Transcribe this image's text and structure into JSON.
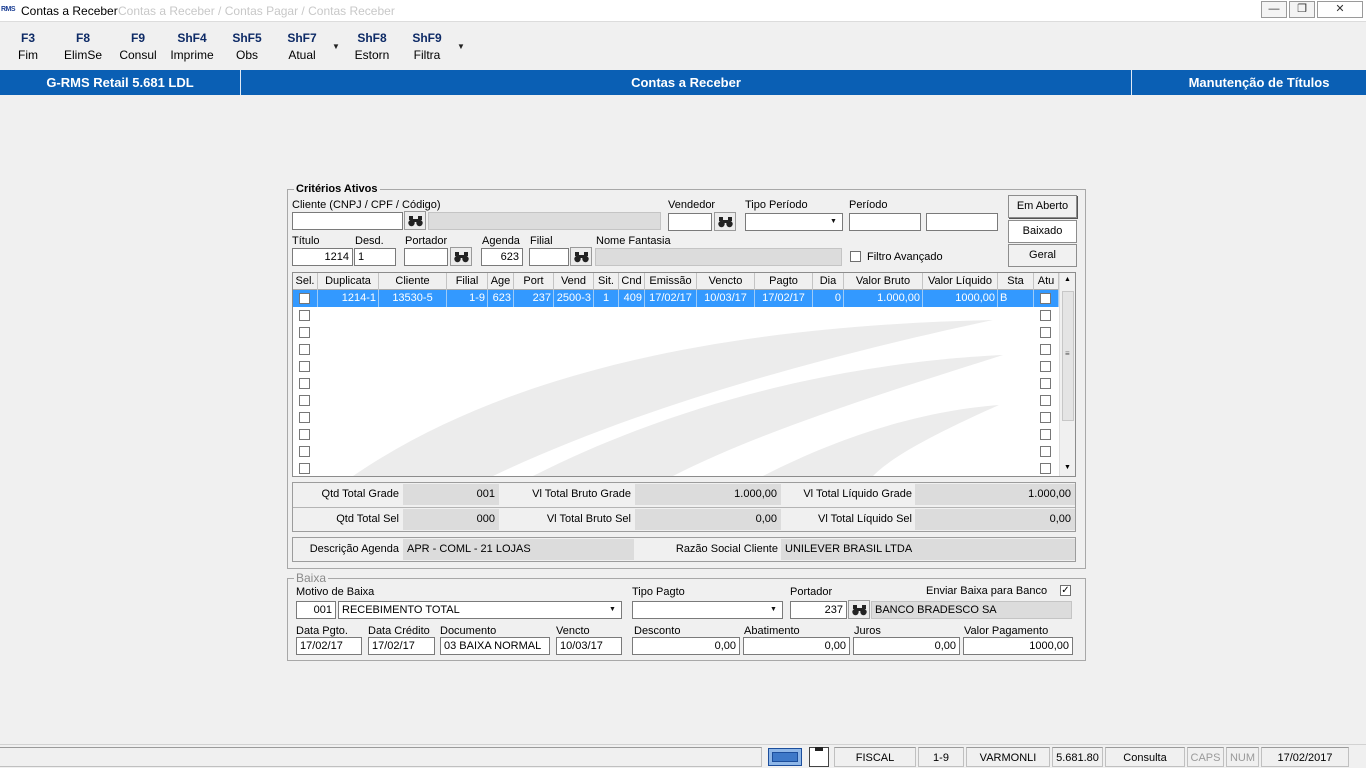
{
  "window": {
    "logo_text": "RMS",
    "title": "Contas a Receber",
    "ghost_title": "Contas a Receber / Contas Pagar / Contas Receber"
  },
  "toolbar": [
    {
      "key": "F3",
      "label": "Fim"
    },
    {
      "key": "F8",
      "label": "ElimSe"
    },
    {
      "key": "F9",
      "label": "Consul"
    },
    {
      "key": "ShF4",
      "label": "Imprime"
    },
    {
      "key": "ShF5",
      "label": "Obs"
    },
    {
      "key": "ShF7",
      "label": "Atual"
    },
    {
      "key": "ShF8",
      "label": "Estorn"
    },
    {
      "key": "ShF9",
      "label": "Filtra"
    }
  ],
  "header": {
    "left": "G-RMS Retail 5.681 LDL",
    "center": "Contas a Receber",
    "right": "Manutenção de Títulos"
  },
  "criteria": {
    "title": "Critérios Ativos",
    "cliente_label": "Cliente (CNPJ / CPF / Código)",
    "cliente_value": "",
    "vendedor_label": "Vendedor",
    "tipo_periodo_label": "Tipo Período",
    "periodo_label": "Período",
    "titulo_label": "Título",
    "titulo_value": "1214",
    "desd_label": "Desd.",
    "desd_value": "1",
    "portador_label": "Portador",
    "agenda_label": "Agenda",
    "agenda_value": "623",
    "filial_label": "Filial",
    "nome_fantasia_label": "Nome Fantasia",
    "filtro_avancado_label": "Filtro Avançado",
    "btn_em_aberto": "Em Aberto",
    "btn_baixado": "Baixado",
    "btn_geral": "Geral"
  },
  "grid": {
    "columns": [
      "Sel.",
      "Duplicata",
      "Cliente",
      "Filial",
      "Age",
      "Port",
      "Vend",
      "Sit.",
      "Cnd",
      "Emissão",
      "Vencto",
      "Pagto",
      "Dia",
      "Valor Bruto",
      "Valor Líquido",
      "Sta",
      "Atu"
    ],
    "rows": [
      {
        "duplicata": "1214-1",
        "cliente": "13530-5",
        "filial": "1-9",
        "age": "623",
        "port": "237",
        "vend": "2500-3",
        "sit": "1",
        "cnd": "409",
        "emissao": "17/02/17",
        "vencto": "10/03/17",
        "pagto": "17/02/17",
        "dia": "0",
        "valor_bruto": "1.000,00",
        "valor_liquido": "1000,00",
        "sta": "B"
      }
    ],
    "empty_rows": 10
  },
  "totals": {
    "qtd_total_grade_label": "Qtd Total Grade",
    "qtd_total_grade": "001",
    "vl_total_bruto_grade_label": "Vl Total Bruto Grade",
    "vl_total_bruto_grade": "1.000,00",
    "vl_total_liquido_grade_label": "Vl Total Líquido Grade",
    "vl_total_liquido_grade": "1.000,00",
    "qtd_total_sel_label": "Qtd Total Sel",
    "qtd_total_sel": "000",
    "vl_total_bruto_sel_label": "Vl Total Bruto Sel",
    "vl_total_bruto_sel": "0,00",
    "vl_total_liquido_sel_label": "Vl Total Líquido Sel",
    "vl_total_liquido_sel": "0,00"
  },
  "descricao": {
    "agenda_label": "Descrição Agenda",
    "agenda_value": "APR - COML - 21 LOJAS",
    "razao_label": "Razão Social Cliente",
    "razao_value": "UNILEVER BRASIL LTDA"
  },
  "baixa": {
    "title": "Baixa",
    "motivo_label": "Motivo de Baixa",
    "motivo_code": "001",
    "motivo_value": "RECEBIMENTO TOTAL",
    "tipo_pagto_label": "Tipo Pagto",
    "tipo_pagto_value": "",
    "portador_label": "Portador",
    "portador_code": "237",
    "portador_name": "BANCO BRADESCO SA",
    "enviar_label": "Enviar Baixa para Banco",
    "enviar_checked": "✓",
    "data_pgto_label": "Data Pgto.",
    "data_pgto": "17/02/17",
    "data_credito_label": "Data Crédito",
    "data_credito": "17/02/17",
    "documento_label": "Documento",
    "documento": "03 BAIXA NORMAL",
    "vencto_label": "Vencto",
    "vencto": "10/03/17",
    "desconto_label": "Desconto",
    "desconto": "0,00",
    "abatimento_label": "Abatimento",
    "abatimento": "0,00",
    "juros_label": "Juros",
    "juros": "0,00",
    "valor_pagamento_label": "Valor Pagamento",
    "valor_pagamento": "1000,00"
  },
  "statusbar": {
    "fiscal": "FISCAL",
    "filial": "1-9",
    "user": "VARMONLI",
    "version": "5.681.80",
    "mode": "Consulta",
    "caps": "CAPS",
    "num": "NUM",
    "date": "17/02/2017"
  },
  "colors": {
    "header_blue": "#0a5fb4",
    "selection_blue": "#3399ff",
    "key_navy": "#0d2a66"
  }
}
